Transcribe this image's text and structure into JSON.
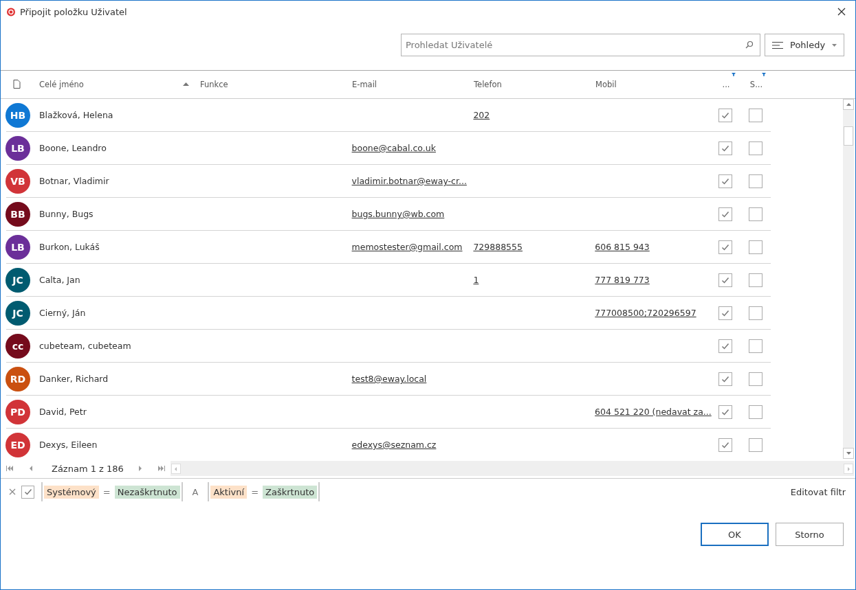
{
  "window": {
    "title": "Připojit položku Uživatel"
  },
  "search": {
    "placeholder": "Prohledat Uživatelé"
  },
  "views_button": "Pohledy",
  "table": {
    "columns": [
      {
        "label": "Celé jméno",
        "sorted": true,
        "filtered": false
      },
      {
        "label": "Funkce",
        "sorted": false,
        "filtered": false
      },
      {
        "label": "E-mail",
        "sorted": false,
        "filtered": false
      },
      {
        "label": "Telefon",
        "sorted": false,
        "filtered": false
      },
      {
        "label": "Mobil",
        "sorted": false,
        "filtered": false
      },
      {
        "label": "...",
        "sorted": false,
        "filtered": true
      },
      {
        "label": "S...",
        "sorted": false,
        "filtered": true
      }
    ],
    "rows": [
      {
        "initials": "HB",
        "color": "#0f78d4",
        "name": "Blažková, Helena",
        "email": "",
        "phone": "202",
        "mobile": "",
        "checked_1": true,
        "checked_2": false
      },
      {
        "initials": "LB",
        "color": "#6b2f99",
        "name": "Boone, Leandro",
        "email": "boone@cabal.co.uk",
        "phone": "",
        "mobile": "",
        "checked_1": true,
        "checked_2": false
      },
      {
        "initials": "VB",
        "color": "#d13438",
        "name": "Botnar, Vladimir",
        "email": "vladimir.botnar@eway-cr...",
        "phone": "",
        "mobile": "",
        "checked_1": true,
        "checked_2": false
      },
      {
        "initials": "BB",
        "color": "#750b1c",
        "name": "Bunny, Bugs",
        "email": "bugs.bunny@wb.com",
        "phone": "",
        "mobile": "",
        "checked_1": true,
        "checked_2": false
      },
      {
        "initials": "LB",
        "color": "#6b2f99",
        "name": "Burkon, Lukáš",
        "email": "memostester@gmail.com",
        "phone": "729888555",
        "mobile": "606 815 943",
        "checked_1": true,
        "checked_2": false
      },
      {
        "initials": "JC",
        "color": "#005b70",
        "name": "Calta, Jan",
        "email": "",
        "phone": "1",
        "mobile": "777 819 773",
        "checked_1": true,
        "checked_2": false
      },
      {
        "initials": "JC",
        "color": "#005b70",
        "name": "Cierný, Ján",
        "email": "",
        "phone": "",
        "mobile": "777008500;720296597",
        "checked_1": true,
        "checked_2": false
      },
      {
        "initials": "cc",
        "color": "#750b1c",
        "name": "cubeteam, cubeteam",
        "email": "",
        "phone": "",
        "mobile": "",
        "checked_1": true,
        "checked_2": false
      },
      {
        "initials": "RD",
        "color": "#ca5010",
        "name": "Danker, Richard",
        "email": "test8@eway.local",
        "phone": "",
        "mobile": "",
        "checked_1": true,
        "checked_2": false
      },
      {
        "initials": "PD",
        "color": "#d13438",
        "name": "David, Petr",
        "email": "",
        "phone": "",
        "mobile": "604 521 220 (nedavat za...",
        "checked_1": true,
        "checked_2": false
      },
      {
        "initials": "ED",
        "color": "#d13438",
        "name": "Dexys, Eileen",
        "email": "edexys@seznam.cz",
        "phone": "",
        "mobile": "",
        "checked_1": true,
        "checked_2": false
      }
    ]
  },
  "pager": {
    "text": "Záznam 1 z 186"
  },
  "filter": {
    "enabled": true,
    "conditions": [
      {
        "field": "Systémový",
        "operator": "=",
        "value": "Nezaškrtnuto"
      },
      {
        "field": "Aktivní",
        "operator": "=",
        "value": "Zaškrtnuto"
      }
    ],
    "joiner": "A",
    "edit_link": "Editovat filtr"
  },
  "buttons": [
    {
      "label": "OK",
      "default": true
    },
    {
      "label": "Storno",
      "default": false
    }
  ]
}
